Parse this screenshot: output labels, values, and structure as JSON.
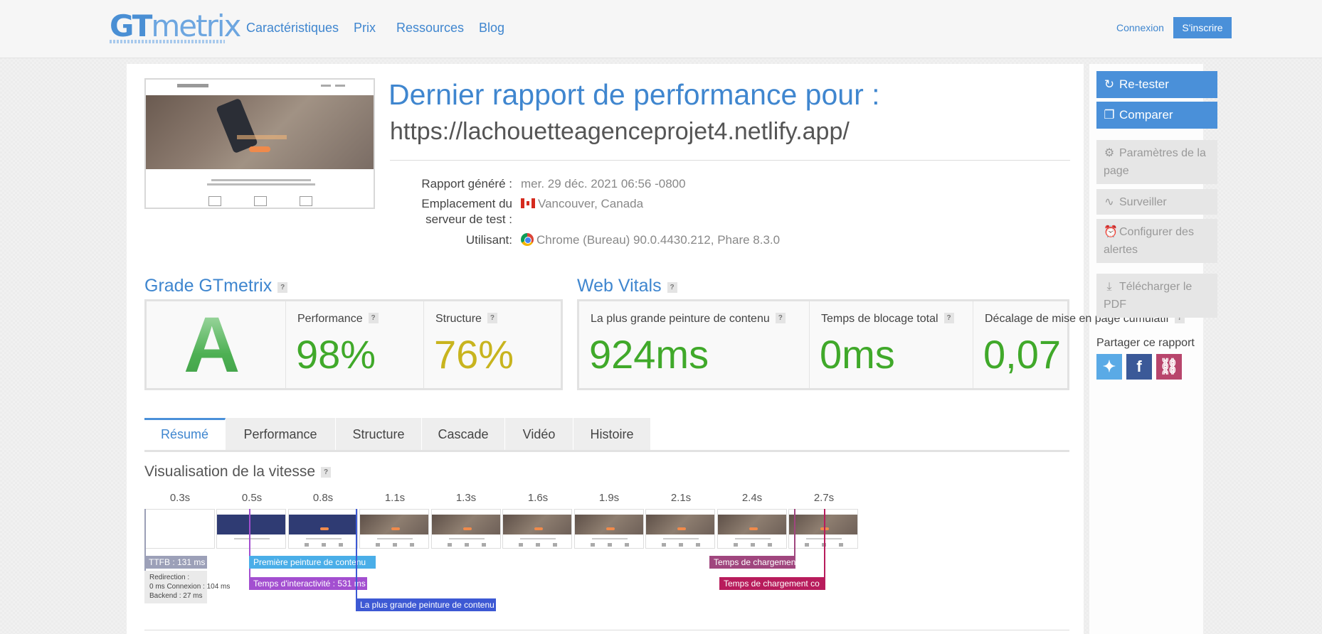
{
  "header": {
    "logo": "GTmetrix",
    "nav": [
      "Caractéristiques",
      "Prix",
      "Ressources",
      "Blog"
    ],
    "login": "Connexion",
    "signup": "S'inscrire"
  },
  "report": {
    "title": "Dernier rapport de performance pour :",
    "url": "https://lachouetteagenceprojet4.netlify.app/",
    "meta": [
      {
        "label": "Rapport généré :",
        "value": "mer. 29 déc. 2021 06:56 -0800"
      },
      {
        "label": "Emplacement du serveur de test :",
        "value": "Vancouver, Canada",
        "icon": "canada-flag-icon"
      },
      {
        "label": "Utilisant:",
        "value": "Chrome (Bureau) 90.0.4430.212, Phare 8.3.0",
        "icon": "chrome-icon"
      }
    ]
  },
  "grade": {
    "title": "Grade GTmetrix",
    "letter": "A",
    "performance_label": "Performance",
    "performance_value": "98%",
    "structure_label": "Structure",
    "structure_value": "76%"
  },
  "vitals": {
    "title": "Web Vitals",
    "lcp_label": "La plus grande peinture de contenu",
    "lcp_value": "924ms",
    "tbt_label": "Temps de blocage total",
    "tbt_value": "0ms",
    "cls_label": "Décalage de mise en page cumulatif",
    "cls_value": "0,07"
  },
  "colors": {
    "accent": "#4a90d9",
    "good": "#40a92a",
    "ok": "#c8b41e"
  },
  "tabs": [
    "Résumé",
    "Performance",
    "Structure",
    "Cascade",
    "Vidéo",
    "Histoire"
  ],
  "active_tab": "Résumé",
  "speed": {
    "title": "Visualisation de la vitesse",
    "ticks": [
      "0.3s",
      "0.5s",
      "0.8s",
      "1.1s",
      "1.3s",
      "1.6s",
      "1.9s",
      "2.1s",
      "2.4s",
      "2.7s"
    ],
    "markers": {
      "ttfb": "TTFB : 131 ms",
      "ttfb_details": [
        "Redirection :",
        "0 ms Connexion : 104 ms",
        "Backend : 27 ms"
      ],
      "fcp": "Première peinture de contenu",
      "tti": "Temps d'interactivité : 531 ms",
      "lcp": "La plus grande peinture de contenu",
      "onload": "Temps de chargement",
      "fully_loaded": "Temps de chargement co"
    }
  },
  "sidebar": {
    "retest": "Re-tester",
    "compare": "Comparer",
    "page_settings": "Paramètres de la page",
    "monitor": "Surveiller",
    "alerts": "Configurer des alertes",
    "pdf": "Télécharger le PDF",
    "share_title": "Partager ce rapport",
    "share": [
      "twitter-icon",
      "facebook-icon",
      "link-icon"
    ]
  }
}
